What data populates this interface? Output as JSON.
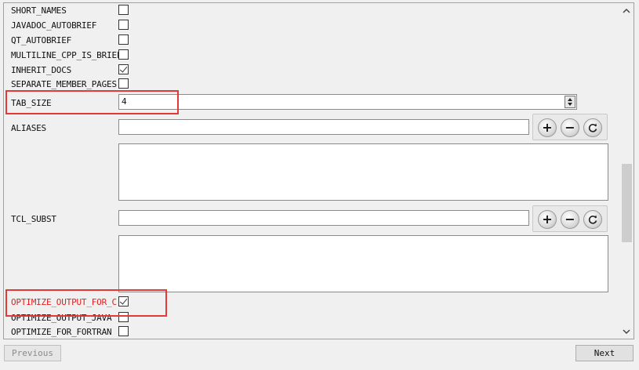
{
  "options": [
    {
      "label": "SHORT_NAMES",
      "checked": false
    },
    {
      "label": "JAVADOC_AUTOBRIEF",
      "checked": false
    },
    {
      "label": "QT_AUTOBRIEF",
      "checked": false
    },
    {
      "label": "MULTILINE_CPP_IS_BRIEF",
      "checked": false
    },
    {
      "label": "INHERIT_DOCS",
      "checked": true
    },
    {
      "label": "SEPARATE_MEMBER_PAGES",
      "checked": false
    }
  ],
  "tab_size": {
    "label": "TAB_SIZE",
    "value": "4"
  },
  "aliases": {
    "label": "ALIASES",
    "value": "",
    "items": []
  },
  "tcl_subst": {
    "label": "TCL_SUBST",
    "value": "",
    "items": []
  },
  "list_buttons": {
    "add": "+",
    "remove": "−",
    "update_icon": "refresh-icon"
  },
  "optimize_c": {
    "label": "OPTIMIZE_OUTPUT_FOR_C",
    "checked": true,
    "color": "#e02020"
  },
  "optimize_java": {
    "label": "OPTIMIZE_OUTPUT_JAVA",
    "checked": false
  },
  "optimize_fortran": {
    "label": "OPTIMIZE_FOR_FORTRAN",
    "checked": false
  },
  "nav": {
    "previous": "Previous",
    "next": "Next"
  },
  "highlight_color": "#e53935"
}
